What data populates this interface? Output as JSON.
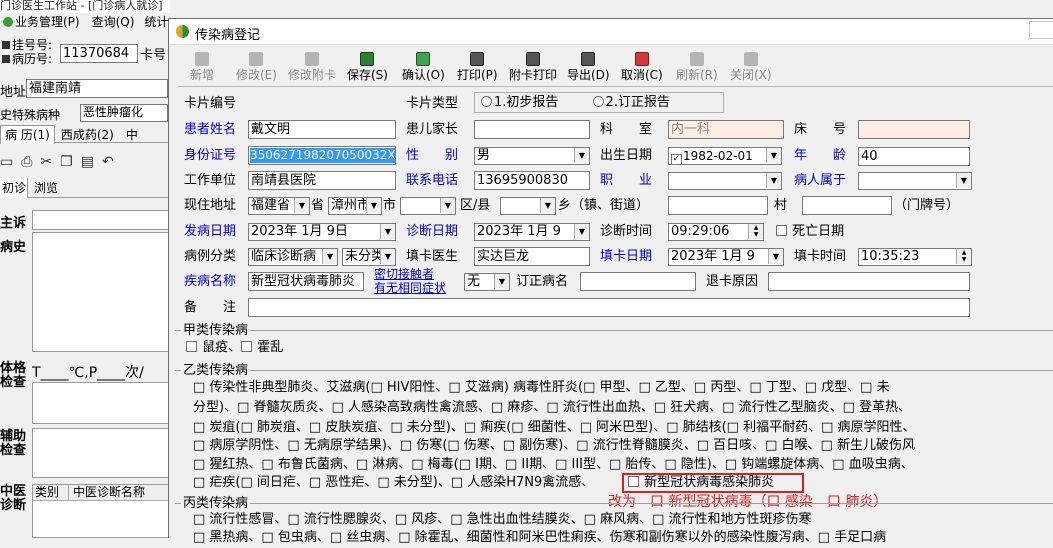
{
  "outer": {
    "title": "门诊医生工作站 - [门诊病人就诊]",
    "menu": [
      "业务管理(P)",
      "查询(Q)",
      "统计"
    ],
    "patient": {
      "reg_label": "挂号号:",
      "record_label": "病历号:",
      "reg_value": "11370684",
      "card_label": "卡号",
      "addr_label": "地址:",
      "addr_value": "福建南靖",
      "history_label": "史特殊病种",
      "history_value": "恶性肿瘤化"
    },
    "tabs": [
      "病 历(1)",
      "西成药(2)",
      "中"
    ],
    "subtabs": [
      "初诊",
      "浏览"
    ],
    "sections": [
      "主诉",
      "病史",
      "体格检查",
      "辅助检查",
      "中医诊断"
    ],
    "vitals": "T____℃,P____次/",
    "tcm_cols": [
      "类别",
      "中医诊断名称"
    ]
  },
  "dialog": {
    "title": "传染病登记",
    "toolbar": [
      {
        "label": "新增",
        "enabled": false
      },
      {
        "label": "修改(E)",
        "enabled": false
      },
      {
        "label": "修改附卡",
        "enabled": false
      },
      {
        "label": "保存(S)",
        "enabled": true
      },
      {
        "label": "确认(O)",
        "enabled": true
      },
      {
        "label": "打印(P)",
        "enabled": true
      },
      {
        "label": "附卡打印",
        "enabled": true
      },
      {
        "label": "导出(D)",
        "enabled": true
      },
      {
        "label": "取消(C)",
        "enabled": true
      },
      {
        "label": "刷新(R)",
        "enabled": false
      },
      {
        "label": "关闭(X)",
        "enabled": false
      }
    ],
    "form": {
      "card_no_label": "卡片编号",
      "card_type_label": "卡片类型",
      "card_type_opt1": "1.初步报告",
      "card_type_opt2": "2.订正报告",
      "name_label": "患者姓名",
      "name_value": "戴文明",
      "parent_label": "患儿家长",
      "parent_value": "",
      "dept_label": "科　　室",
      "dept_value": "内一科",
      "bed_label": "床　　号",
      "bed_value": "",
      "id_label": "身份证号",
      "id_value": "350627198207050032X",
      "sex_label": "性　　别",
      "sex_value": "男",
      "birth_label": "出生日期",
      "birth_value": "1982-02-01",
      "age_label": "年　　龄",
      "age_value": "40",
      "work_label": "工作单位",
      "work_value": "南靖县医院",
      "phone_label": "联系电话",
      "phone_value": "13695900830",
      "job_label": "职　　业",
      "job_value": "",
      "belong_label": "病人属于",
      "belong_value": "",
      "addr_label": "现住地址",
      "province_value": "福建省",
      "province_suffix": "省",
      "city_value": "漳州市",
      "city_suffix": "市",
      "district_suffix": "区/县",
      "town_suffix": "乡（镇、街道）",
      "village_suffix": "村",
      "house_suffix": "（门牌号）",
      "onset_label": "发病日期",
      "onset_value": "2023年 1月 9日",
      "diag_date_label": "诊断日期",
      "diag_date_value": "2023年 1月 9",
      "diag_time_label": "诊断时间",
      "diag_time_value": "09:29:06",
      "death_label": "死亡日期",
      "case_type_label": "病例分类",
      "case_type_value": "临床诊断病",
      "case_type2_value": "未分类",
      "doctor_label": "填卡医生",
      "doctor_value": "实达巨龙",
      "fill_date_label": "填卡日期",
      "fill_date_value": "2023年 1月 9",
      "fill_time_label": "填卡时间",
      "fill_time_value": "10:35:23",
      "disease_label": "疾病名称",
      "disease_value": "新型冠状病毒肺炎",
      "contact_label1": "密切接触者",
      "contact_label2": "有无相同症状",
      "contact_value": "无",
      "revised_label": "订正病名",
      "return_label": "退卡原因",
      "remark_label": "备　　注"
    },
    "class_a": {
      "header": "甲类传染病",
      "line1": "鼠疫、",
      "line1b": "霍乱"
    },
    "class_b": {
      "header": "乙类传染病",
      "lines": [
        "□ 传染性非典型肺炎、艾滋病(□ HIV阳性、□ 艾滋病) 病毒性肝炎(□ 甲型、□ 乙型、□ 丙型、□ 丁型、□ 戊型、□ 未",
        "分型)、□ 脊髓灰质炎、□ 人感染高致病性禽流感、□ 麻疹、□ 流行性出血热、□ 狂犬病、□ 流行性乙型脑炎、□ 登革热、",
        "□ 炭疽(□ 肺炭疽、□ 皮肤炭疽、□ 未分型)、□ 痢疾(□ 细菌性、□ 阿米巴型)、□ 肺结核(□ 利福平耐药、□ 病原学阳性、",
        "□ 病原学阴性、□ 无病原学结果)、□ 伤寒(□ 伤寒、□ 副伤寒)、□ 流行性脊髓膜炎、□ 百日咳、□ 白喉、□ 新生儿破伤风",
        "□ 猩红热、□ 布鲁氏菌病、□ 淋病、□ 梅毒(□ I期、□ II期、□ III型、□ 胎传、□ 隐性)、□ 钩端螺旋体病、□ 血吸虫病、",
        "□ 疟疾(□ 间日疟、□ 恶性疟、□ 未分型)、□ 人感染H7N9禽流感、"
      ],
      "highlight": "新型冠状病毒感染肺炎",
      "annotation": "改为　口 新型冠状病毒（口 感染　口 肺炎）"
    },
    "class_c": {
      "header": "丙类传染病",
      "lines": [
        "□ 流行性感冒、□ 流行性腮腺炎、□ 风疹、□ 急性出血性结膜炎、□ 麻风病、□ 流行性和地方性斑疹伤寒",
        "□ 黑热病、□ 包虫病、□ 丝虫病、□ 除霍乱、细菌性和阿米巴性痢疾、伤寒和副伤寒以外的感染性腹泻病、□ 手足口病"
      ]
    }
  },
  "colors": {
    "accent_blue": "#0000cc",
    "highlight_red": "#e02020",
    "selection": "#3399ff",
    "readonly_pink": "#fdeee4"
  }
}
